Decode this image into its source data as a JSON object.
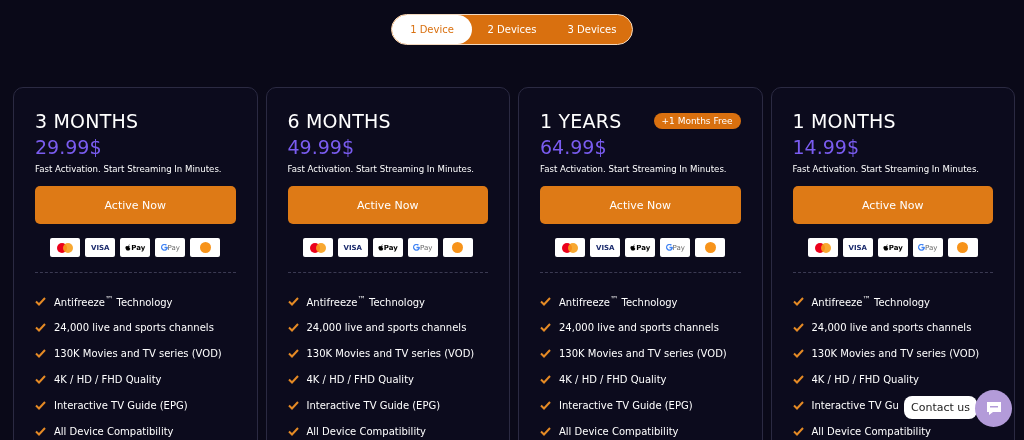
{
  "device_tabs": [
    {
      "label": "1 Device",
      "selected": true
    },
    {
      "label": "2 Devices",
      "selected": false
    },
    {
      "label": "3 Devices",
      "selected": false
    }
  ],
  "plans": [
    {
      "title": "3 MONTHS",
      "price": "29.99$",
      "tagline": "Fast Activation. Start Streaming In Minutes.",
      "button": "Active Now",
      "payments": [
        {
          "kind": "mastercard"
        },
        {
          "kind": "visa",
          "label": "VISA"
        },
        {
          "kind": "applepay",
          "label": "Pay"
        },
        {
          "kind": "gpay",
          "label": "Pay"
        },
        {
          "kind": "bitcoin"
        }
      ],
      "features": [
        "Antifreeze$^{™}$ Technology",
        "24,000 live and sports channels",
        "130K Movies and TV series (VOD)",
        "4K / HD / FHD Quality",
        "Interactive TV Guide (EPG)",
        "All Device Compatibility"
      ]
    },
    {
      "title": "6 MONTHS",
      "price": "49.99$",
      "tagline": "Fast Activation. Start Streaming In Minutes.",
      "button": "Active Now",
      "payments": [
        {
          "kind": "mastercard"
        },
        {
          "kind": "visa",
          "label": "VISA"
        },
        {
          "kind": "applepay",
          "label": "Pay"
        },
        {
          "kind": "gpay",
          "label": "Pay"
        },
        {
          "kind": "bitcoin"
        }
      ],
      "features": [
        "Antifreeze$^{™}$ Technology",
        "24,000 live and sports channels",
        "130K Movies and TV series (VOD)",
        "4K / HD / FHD Quality",
        "Interactive TV Guide (EPG)",
        "All Device Compatibility"
      ]
    },
    {
      "title": "1 YEARS",
      "badge": "+1 Months Free",
      "price": "64.99$",
      "tagline": "Fast Activation. Start Streaming In Minutes.",
      "button": "Active Now",
      "payments": [
        {
          "kind": "mastercard"
        },
        {
          "kind": "visa",
          "label": "VISA"
        },
        {
          "kind": "applepay",
          "label": "Pay"
        },
        {
          "kind": "gpay",
          "label": "Pay"
        },
        {
          "kind": "bitcoin"
        }
      ],
      "features": [
        "Antifreeze$^{™}$ Technology",
        "24,000 live and sports channels",
        "130K Movies and TV series (VOD)",
        "4K / HD / FHD Quality",
        "Interactive TV Guide (EPG)",
        "All Device Compatibility"
      ]
    },
    {
      "title": "1 MONTHS",
      "price": "14.99$",
      "tagline": "Fast Activation. Start Streaming In Minutes.",
      "button": "Active Now",
      "payments": [
        {
          "kind": "mastercard"
        },
        {
          "kind": "visa",
          "label": "VISA"
        },
        {
          "kind": "applepay",
          "label": "Pay"
        },
        {
          "kind": "gpay",
          "label": "Pay"
        },
        {
          "kind": "bitcoin"
        }
      ],
      "features": [
        "Antifreeze$^{™}$ Technology",
        "24,000 live and sports channels",
        "130K Movies and TV series (VOD)",
        "4K / HD / FHD Quality",
        "Interactive TV Gu",
        "All Device Compatibility"
      ]
    }
  ],
  "contact": {
    "label": "Contact us"
  }
}
